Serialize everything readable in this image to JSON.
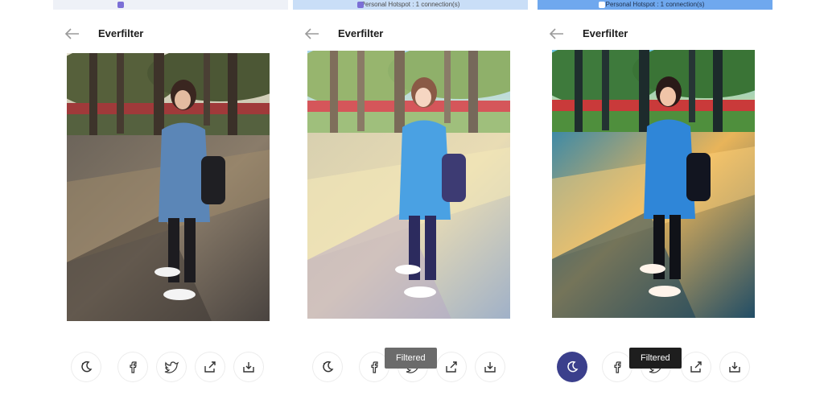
{
  "screens": [
    {
      "status_text": "",
      "status_bg": "#eef1f7",
      "title": "Everfilter",
      "photo_variant": "original",
      "active_button": "",
      "toast": ""
    },
    {
      "status_text": "Personal Hotspot : 1 connection(s)",
      "status_bg": "#c9def7",
      "title": "Everfilter",
      "photo_variant": "pastel",
      "active_button": "",
      "toast": "Filtered"
    },
    {
      "status_text": "Personal Hotspot : 1 connection(s)",
      "status_bg": "#6fa8ee",
      "title": "Everfilter",
      "photo_variant": "vivid",
      "active_button": "filter",
      "toast": "Filtered"
    }
  ],
  "buttons": [
    {
      "name": "filter-icon",
      "label": "filter"
    },
    {
      "name": "facebook-icon",
      "label": "facebook"
    },
    {
      "name": "twitter-icon",
      "label": "twitter"
    },
    {
      "name": "share-icon",
      "label": "share"
    },
    {
      "name": "download-icon",
      "label": "download"
    }
  ],
  "colors": {
    "accent": "#3b3f8c",
    "toast_light": "#6b6b6b",
    "toast_dark": "#1e1e1e"
  }
}
